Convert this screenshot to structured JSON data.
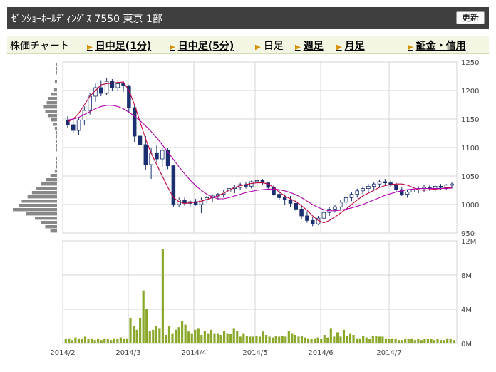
{
  "header": {
    "title": "ｾﾞﾝｼｮｰﾎｰﾙﾃﾞｨﾝｸﾞｽ  7550  東京 1部",
    "refresh_label": "更新"
  },
  "nav": {
    "items": [
      {
        "label": "株価チャート",
        "link": false,
        "arrow": false
      },
      {
        "label": "日中足(1分)",
        "link": true,
        "arrow": true
      },
      {
        "label": "日中足(5分)",
        "link": true,
        "arrow": true
      },
      {
        "label": "日足",
        "link": false,
        "arrow": true
      },
      {
        "label": "週足",
        "link": true,
        "arrow": true
      },
      {
        "label": "月足",
        "link": true,
        "arrow": true
      },
      {
        "label": "証金・信用",
        "link": true,
        "arrow": true
      }
    ]
  },
  "colors": {
    "up_candle": "#ffffff",
    "down_candle": "#1a2f70",
    "ma_short": "#c0003c",
    "ma_long": "#b000b0",
    "volume": "#8aa82a",
    "volume_profile": "#888888",
    "grid": "#d4d4d4"
  },
  "chart_data": [
    {
      "type": "candlestick",
      "x_tick_labels": [
        "2014/2",
        "2014/3",
        "2014/4",
        "2014/5",
        "2014/6",
        "2014/7"
      ],
      "ylim": [
        950,
        1250
      ],
      "y_ticks": [
        950,
        1000,
        1050,
        1100,
        1150,
        1200,
        1250
      ],
      "grid": true,
      "series": [
        {
          "name": "",
          "role": "ma_short",
          "values": [
            1145,
            1150,
            1160,
            1175,
            1190,
            1200,
            1210,
            1212,
            1213,
            1214,
            1215,
            1200,
            1175,
            1145,
            1115,
            1090,
            1070,
            1050,
            1030,
            1012,
            1005,
            1002,
            1003,
            1004,
            1006,
            1009,
            1012,
            1015,
            1020,
            1025,
            1030,
            1033,
            1035,
            1037,
            1038,
            1038,
            1036,
            1030,
            1022,
            1015,
            1010,
            1005,
            998,
            990,
            980,
            972,
            968,
            972,
            978,
            985,
            992,
            1000,
            1008,
            1015,
            1020,
            1025,
            1030,
            1033,
            1035,
            1036,
            1036,
            1034,
            1030,
            1026,
            1025,
            1026,
            1027,
            1028,
            1029,
            1030
          ]
        },
        {
          "name": "",
          "role": "ma_long",
          "values": [
            1148,
            1150,
            1153,
            1158,
            1163,
            1168,
            1172,
            1174,
            1174,
            1172,
            1168,
            1162,
            1155,
            1147,
            1138,
            1128,
            1117,
            1105,
            1092,
            1079,
            1066,
            1054,
            1043,
            1033,
            1025,
            1018,
            1013,
            1010,
            1010,
            1012,
            1015,
            1018,
            1021,
            1023,
            1025,
            1026,
            1027,
            1027,
            1026,
            1024,
            1021,
            1017,
            1012,
            1006,
            1000,
            995,
            991,
            989,
            989,
            990,
            992,
            994,
            997,
            1000,
            1004,
            1008,
            1012,
            1016,
            1019,
            1022,
            1024,
            1026,
            1027,
            1028,
            1028,
            1028,
            1028,
            1028,
            1028,
            1029
          ]
        }
      ],
      "candles": [
        [
          1148,
          1155,
          1135,
          1140
        ],
        [
          1140,
          1150,
          1125,
          1130
        ],
        [
          1130,
          1152,
          1122,
          1148
        ],
        [
          1148,
          1172,
          1140,
          1165
        ],
        [
          1165,
          1195,
          1158,
          1190
        ],
        [
          1190,
          1212,
          1180,
          1205
        ],
        [
          1205,
          1218,
          1190,
          1195
        ],
        [
          1195,
          1222,
          1192,
          1216
        ],
        [
          1216,
          1220,
          1200,
          1205
        ],
        [
          1205,
          1218,
          1198,
          1212
        ],
        [
          1212,
          1216,
          1198,
          1208
        ],
        [
          1208,
          1210,
          1160,
          1170
        ],
        [
          1170,
          1175,
          1110,
          1120
        ],
        [
          1120,
          1138,
          1095,
          1105
        ],
        [
          1105,
          1120,
          1060,
          1070
        ],
        [
          1070,
          1100,
          1045,
          1090
        ],
        [
          1090,
          1105,
          1075,
          1080
        ],
        [
          1080,
          1100,
          1065,
          1095
        ],
        [
          1095,
          1100,
          1062,
          1068
        ],
        [
          1068,
          1070,
          995,
          1000
        ],
        [
          1000,
          1012,
          995,
          1008
        ],
        [
          1008,
          1012,
          998,
          1002
        ],
        [
          1002,
          1008,
          996,
          1005
        ],
        [
          1005,
          1010,
          998,
          1000
        ],
        [
          1000,
          1012,
          985,
          1008
        ],
        [
          1008,
          1015,
          1002,
          1012
        ],
        [
          1012,
          1018,
          1005,
          1015
        ],
        [
          1015,
          1020,
          1008,
          1018
        ],
        [
          1018,
          1025,
          1012,
          1022
        ],
        [
          1022,
          1030,
          1015,
          1028
        ],
        [
          1028,
          1035,
          1020,
          1030
        ],
        [
          1030,
          1038,
          1025,
          1035
        ],
        [
          1035,
          1040,
          1028,
          1032
        ],
        [
          1032,
          1042,
          1028,
          1040
        ],
        [
          1040,
          1048,
          1032,
          1042
        ],
        [
          1042,
          1045,
          1035,
          1038
        ],
        [
          1038,
          1040,
          1025,
          1030
        ],
        [
          1030,
          1035,
          1015,
          1018
        ],
        [
          1018,
          1025,
          1008,
          1012
        ],
        [
          1012,
          1018,
          1000,
          1008
        ],
        [
          1008,
          1015,
          995,
          1002
        ],
        [
          1002,
          1008,
          988,
          992
        ],
        [
          992,
          998,
          975,
          980
        ],
        [
          980,
          988,
          968,
          972
        ],
        [
          972,
          978,
          962,
          966
        ],
        [
          966,
          980,
          964,
          976
        ],
        [
          976,
          990,
          972,
          986
        ],
        [
          986,
          995,
          980,
          992
        ],
        [
          992,
          1000,
          986,
          996
        ],
        [
          996,
          1008,
          990,
          1004
        ],
        [
          1004,
          1015,
          998,
          1012
        ],
        [
          1012,
          1022,
          1006,
          1018
        ],
        [
          1018,
          1028,
          1012,
          1024
        ],
        [
          1024,
          1032,
          1018,
          1028
        ],
        [
          1028,
          1036,
          1022,
          1032
        ],
        [
          1032,
          1040,
          1026,
          1036
        ],
        [
          1036,
          1044,
          1030,
          1040
        ],
        [
          1040,
          1045,
          1034,
          1038
        ],
        [
          1038,
          1042,
          1030,
          1034
        ],
        [
          1034,
          1038,
          1022,
          1026
        ],
        [
          1026,
          1030,
          1015,
          1018
        ],
        [
          1018,
          1026,
          1012,
          1022
        ],
        [
          1022,
          1030,
          1016,
          1026
        ],
        [
          1026,
          1032,
          1020,
          1028
        ],
        [
          1028,
          1034,
          1022,
          1030
        ],
        [
          1030,
          1035,
          1024,
          1028
        ],
        [
          1028,
          1034,
          1022,
          1032
        ],
        [
          1032,
          1036,
          1026,
          1030
        ],
        [
          1030,
          1036,
          1026,
          1034
        ],
        [
          1034,
          1040,
          1028,
          1036
        ]
      ],
      "volume_profile": [
        2,
        1,
        1,
        0,
        3,
        0,
        4,
        8,
        12,
        14,
        18,
        16,
        12,
        8,
        5,
        3,
        2,
        1,
        2,
        1,
        1,
        0,
        1,
        1,
        1,
        3,
        9,
        15,
        22,
        28,
        34,
        40,
        48,
        52,
        60,
        42,
        30,
        22,
        16,
        9
      ]
    },
    {
      "type": "bar",
      "role": "volume",
      "ylim": [
        0,
        12
      ],
      "y_ticks": [
        0,
        4,
        8,
        12
      ],
      "y_tick_labels": [
        "0M",
        "4M",
        "8M",
        "12M"
      ],
      "grid": true,
      "values": [
        0.5,
        0.6,
        0.4,
        0.7,
        0.6,
        0.5,
        0.8,
        0.5,
        0.6,
        0.4,
        0.5,
        0.4,
        0.6,
        0.5,
        0.4,
        0.6,
        0.5,
        0.7,
        0.5,
        0.6,
        3.0,
        2.0,
        1.6,
        3.0,
        6.2,
        4.0,
        1.5,
        1.6,
        2.0,
        1.8,
        11.0,
        1.0,
        2.0,
        1.2,
        1.6,
        1.9,
        2.6,
        2.2,
        1.4,
        1.2,
        1.6,
        1.8,
        1.0,
        1.5,
        1.2,
        1.6,
        1.2,
        1.2,
        1.0,
        1.5,
        1.2,
        1.1,
        1.8,
        1.5,
        0.8,
        1.2,
        0.9,
        0.8,
        0.8,
        0.9,
        0.8,
        1.4,
        1.0,
        0.8,
        0.7,
        0.9,
        0.8,
        0.9,
        0.8,
        1.5,
        1.2,
        1.0,
        0.8,
        0.9,
        0.7,
        0.6,
        0.5,
        0.6,
        0.7,
        0.5,
        1.0,
        0.7,
        1.8,
        0.8,
        1.3,
        0.8,
        1.6,
        0.9,
        1.2,
        1.0,
        0.6,
        0.6,
        0.9,
        0.7,
        0.5,
        0.9,
        0.9,
        0.8,
        0.8,
        0.6,
        0.5,
        0.6,
        0.5,
        0.4,
        0.4,
        0.5,
        0.5,
        0.6,
        0.4,
        0.5,
        0.4,
        0.5,
        0.5,
        0.5,
        0.4,
        0.5,
        0.4,
        0.4,
        0.6,
        0.5,
        0.4
      ]
    }
  ]
}
